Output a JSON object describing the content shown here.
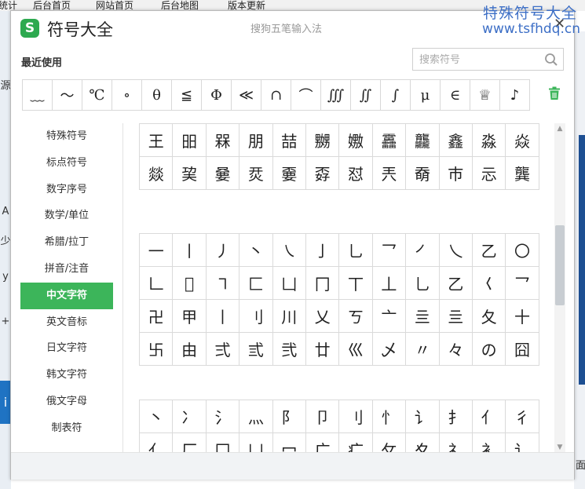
{
  "background": {
    "nav_items": [
      "统计",
      "后台首页",
      "网站首页",
      "后台地图",
      "版本更新"
    ],
    "watermark_title": "特殊符号大全",
    "watermark_url": "www.tsfhdq.cn",
    "left_glyphs": [
      "源",
      "A",
      "少",
      "y",
      "+"
    ],
    "bottom_right_char": "面"
  },
  "window": {
    "app_title": "符号大全",
    "ime_name": "搜狗五笔输入法",
    "logo_letter": "S",
    "close_label": "✕"
  },
  "recent": {
    "label": "最近使用",
    "symbols": [
      "﹏",
      "～",
      "℃",
      "∘",
      "θ",
      "≦",
      "Φ",
      "≪",
      "∩",
      "⌒",
      "∭",
      "∬",
      "∫",
      "μ",
      "∈",
      "♕",
      "♪"
    ]
  },
  "search": {
    "placeholder": "搜索符号"
  },
  "sidebar": {
    "items": [
      {
        "label": "特殊符号"
      },
      {
        "label": "标点符号"
      },
      {
        "label": "数字序号"
      },
      {
        "label": "数学/单位"
      },
      {
        "label": "希腊/拉丁"
      },
      {
        "label": "拼音/注音"
      },
      {
        "label": "中文字符"
      },
      {
        "label": "英文音标"
      },
      {
        "label": "日文字符"
      },
      {
        "label": "韩文字符"
      },
      {
        "label": "俄文字母"
      },
      {
        "label": "制表符"
      }
    ],
    "active_index": 6
  },
  "grids": [
    {
      "rows": [
        [
          "王",
          "昍",
          "槑",
          "朋",
          "喆",
          "嬲",
          "嫐",
          "靐",
          "龘",
          "鑫",
          "淼",
          "焱"
        ],
        [
          "燚",
          "巭",
          "嘦",
          "烎",
          "嫑",
          "孬",
          "怼",
          "兲",
          "奣",
          "巿",
          "忈",
          "龔"
        ]
      ]
    },
    {
      "rows": [
        [
          "一",
          "丨",
          "丿",
          "丶",
          "㇏",
          "亅",
          "乚",
          "乛",
          "㇒",
          "乀",
          "乙",
          "〇"
        ],
        [
          "𠃊",
          "𠃎",
          "㇕",
          "匚",
          "凵",
          "冂",
          "丅",
          "丄",
          "乚",
          "乙",
          "𡿨",
          "乛"
        ],
        [
          "卍",
          "甲",
          "丨",
          "刂",
          "川",
          "乂",
          "ㄎ",
          "亠",
          "亖",
          "亖",
          "夂",
          "十"
        ],
        [
          "卐",
          "由",
          "弍",
          "弎",
          "弐",
          "廿",
          "巛",
          "乄",
          "〃",
          "々",
          "の",
          "囧"
        ]
      ]
    },
    {
      "rows": [
        [
          "丶",
          "冫",
          "氵",
          "灬",
          "阝",
          "卩",
          "刂",
          "忄",
          "讠",
          "扌",
          "亻",
          "彳"
        ],
        [
          "亻",
          "厂",
          "冂",
          "凵",
          "冖",
          "广",
          "疒",
          "攵",
          "夊",
          "礻",
          "衤",
          "讠"
        ]
      ]
    }
  ]
}
